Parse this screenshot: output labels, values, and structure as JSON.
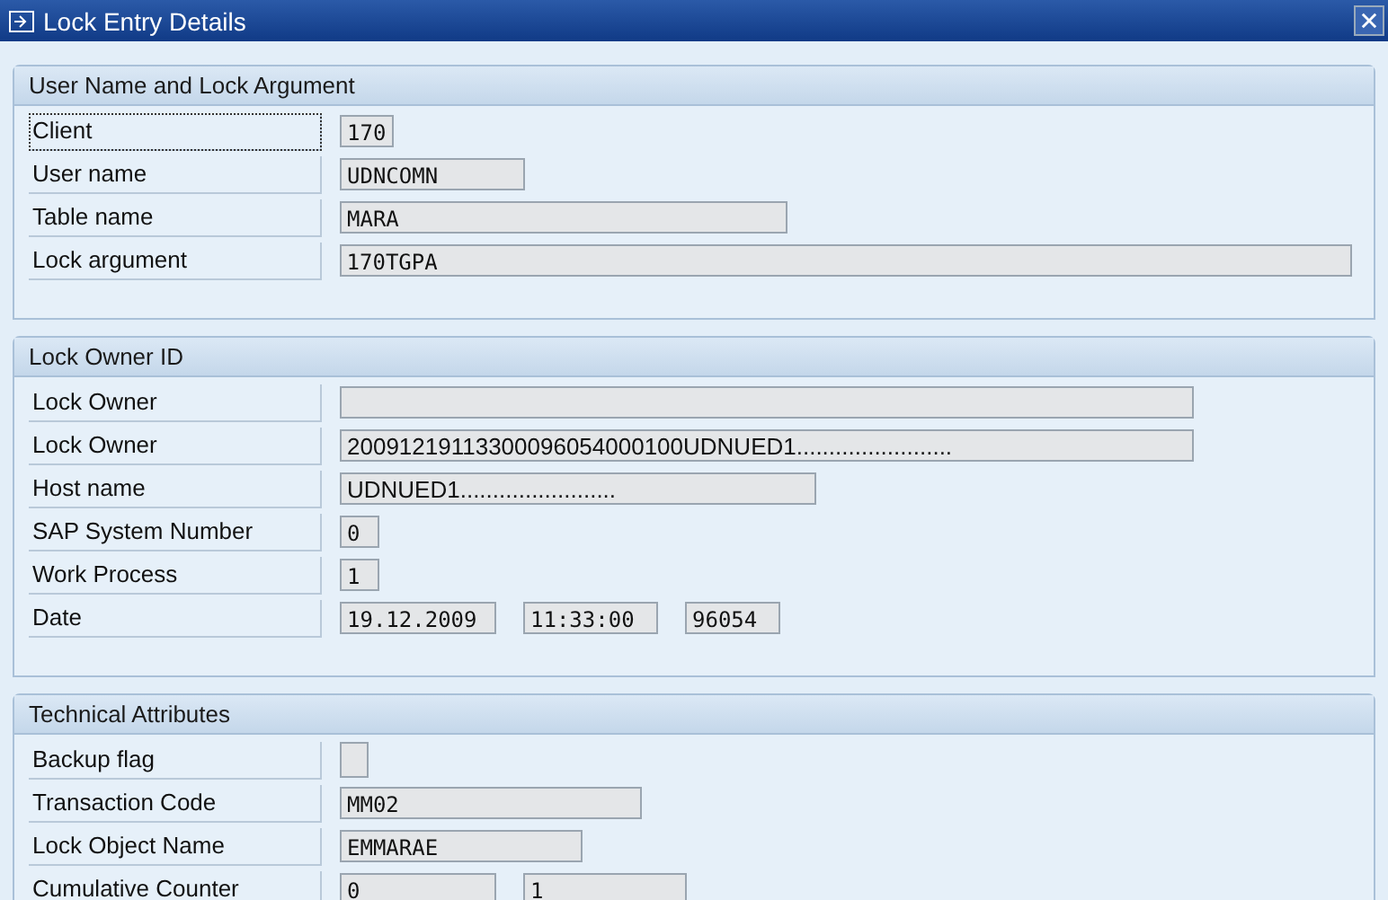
{
  "window": {
    "title": "Lock Entry Details"
  },
  "sections": [
    {
      "title": "User Name and Lock Argument",
      "rows": [
        {
          "label": "Client",
          "focused": true,
          "kind": "fields",
          "fields": [
            "170"
          ]
        },
        {
          "label": "User name",
          "focused": false,
          "kind": "fields",
          "fields": [
            "UDNCOMN"
          ]
        },
        {
          "label": "Table name",
          "focused": false,
          "kind": "fields",
          "fields": [
            "MARA"
          ]
        },
        {
          "label": "Lock argument",
          "focused": false,
          "kind": "fields",
          "fields": [
            "170TGPA"
          ]
        }
      ]
    },
    {
      "title": "Lock Owner ID",
      "rows": [
        {
          "label": "Lock Owner",
          "focused": false,
          "kind": "fields"
        },
        {
          "label": "Lock Owner",
          "focused": false,
          "kind": "fields",
          "fields": [
            "20091219113300096054000100UDNUED1........................"
          ]
        },
        {
          "label": "Host name",
          "focused": false,
          "kind": "fields",
          "fields": [
            "UDNUED1........................"
          ]
        },
        {
          "label": "SAP System Number",
          "focused": false,
          "kind": "fields",
          "fields": [
            "0"
          ]
        },
        {
          "label": "Work Process",
          "focused": false,
          "kind": "fields",
          "fields": [
            "1"
          ]
        },
        {
          "label": "Date",
          "focused": false,
          "kind": "fields",
          "fields": [
            "19.12.2009",
            "11:33:00",
            "96054"
          ]
        }
      ]
    },
    {
      "title": "Technical Attributes",
      "rows": [
        {
          "label": "Backup flag",
          "focused": false,
          "kind": "checkbox",
          "checked": false
        },
        {
          "label": "Transaction Code",
          "focused": false,
          "kind": "fields",
          "fields": [
            "MM02"
          ]
        },
        {
          "label": "Lock Object Name",
          "focused": false,
          "kind": "fields",
          "fields": [
            "EMMARAE"
          ]
        },
        {
          "label": "Cumulative Counter",
          "focused": false,
          "kind": "fields",
          "fields": [
            "0",
            "1"
          ]
        }
      ]
    }
  ]
}
